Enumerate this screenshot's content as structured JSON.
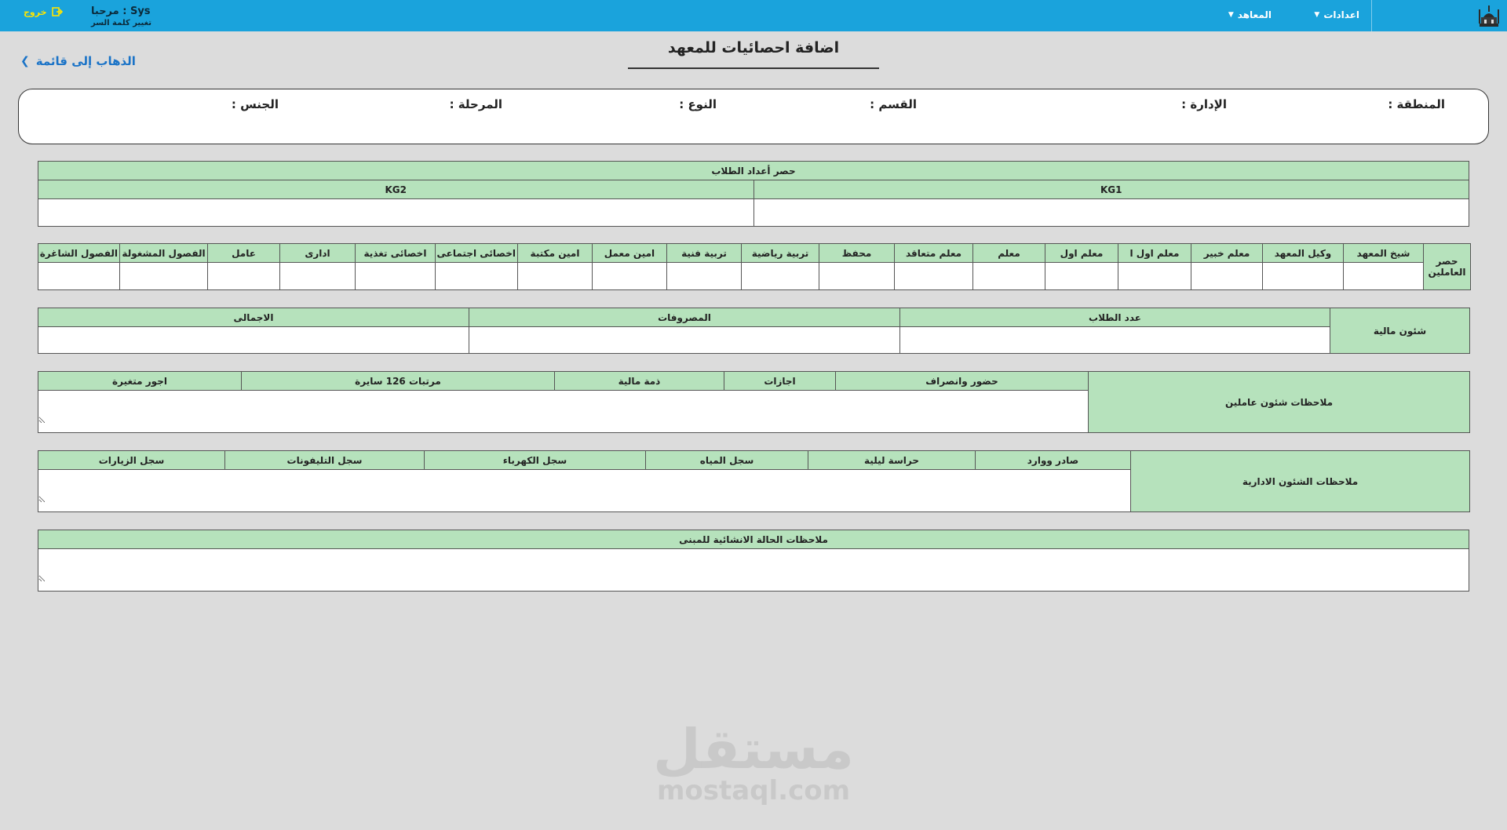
{
  "nav": {
    "settings_label": "اعدادات",
    "institutes_label": "المعاهد",
    "greeting": "مرحبا : Sys",
    "change_password": "تغيير كلمة السر",
    "logout": "خروج"
  },
  "page": {
    "title": "اضافة احصائيات للمعهد",
    "back_link": "الذهاب إلى قائمة"
  },
  "info": {
    "region": "المنطقة :",
    "administration": "الإدارة :",
    "section": "القسم :",
    "type": "النوع :",
    "stage": "المرحلة :",
    "gender": "الجنس :"
  },
  "students": {
    "title": "حصر أعداد الطلاب",
    "columns": [
      "KG1",
      "KG2"
    ]
  },
  "workers": {
    "side_label": "حصر العاملين",
    "columns": [
      "شيخ المعهد",
      "وكيل المعهد",
      "معلم خبير",
      "معلم اول ا",
      "معلم اول",
      "معلم",
      "معلم متعاقد",
      "محفظ",
      "تربية رياضية",
      "تربية فنية",
      "امين معمل",
      "امين مكتبة",
      "اخصائى اجتماعى",
      "اخصائى تغذية",
      "ادارى",
      "عامل",
      "الفصول المشغولة",
      "الفصول الشاغرة"
    ]
  },
  "finance": {
    "side_label": "شئون مالية",
    "columns": [
      "عدد الطلاب",
      "المصروفات",
      "الاجمالى"
    ]
  },
  "staff_notes": {
    "side_label": "ملاحظات شئون عاملين",
    "columns": [
      "حضور وانصراف",
      "اجازات",
      "ذمة مالية",
      "مرتبات 126 سايرة",
      "اجور متغيرة"
    ]
  },
  "admin_notes": {
    "side_label": "ملاحظات الشئون الادارية",
    "columns": [
      "صادر ووارد",
      "حراسة ليلية",
      "سجل المياه",
      "سجل الكهرباء",
      "سجل التليفونات",
      "سجل الزيارات"
    ]
  },
  "building_notes": {
    "title": "ملاحظات الحالة الانشائية للمبنى"
  },
  "watermark": {
    "arabic": "مستقل",
    "latin": "mostaql.com"
  }
}
